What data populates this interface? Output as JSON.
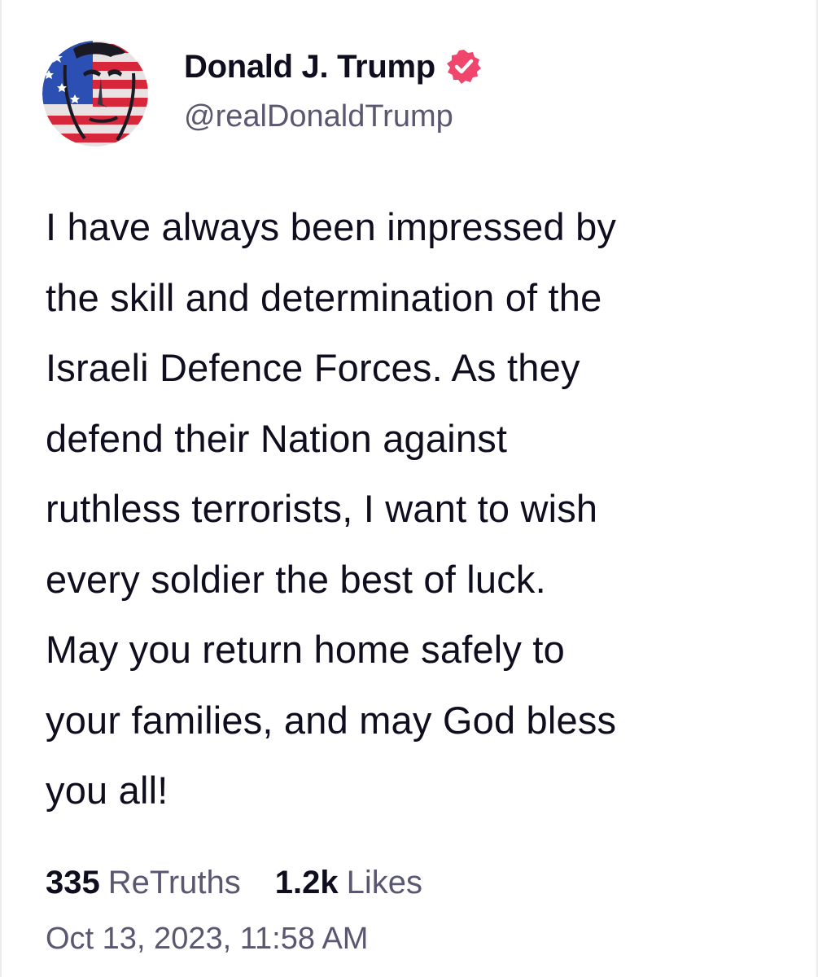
{
  "author": {
    "name": "Donald J. Trump",
    "handle": "@realDonaldTrump",
    "verified": true,
    "verified_badge_color": "#f0466e",
    "avatar_icon": "user-avatar-american-flag-portrait"
  },
  "post": {
    "text": "I have always been impressed by\nthe skill and determination of the\nIsraeli Defence Forces. As they\ndefend their Nation against\nruthless terrorists, I want to wish\nevery soldier the best of luck.\nMay you return home safely to\nyour families, and may God bless\nyou all!"
  },
  "stats": {
    "retruths_count": "335",
    "retruths_label": "ReTruths",
    "likes_count": "1.2k",
    "likes_label": "Likes"
  },
  "timestamp": "Oct 13, 2023, 11:58 AM",
  "colors": {
    "text_primary": "#0f0e1f",
    "text_secondary": "#5a5770",
    "background": "#ffffff"
  }
}
